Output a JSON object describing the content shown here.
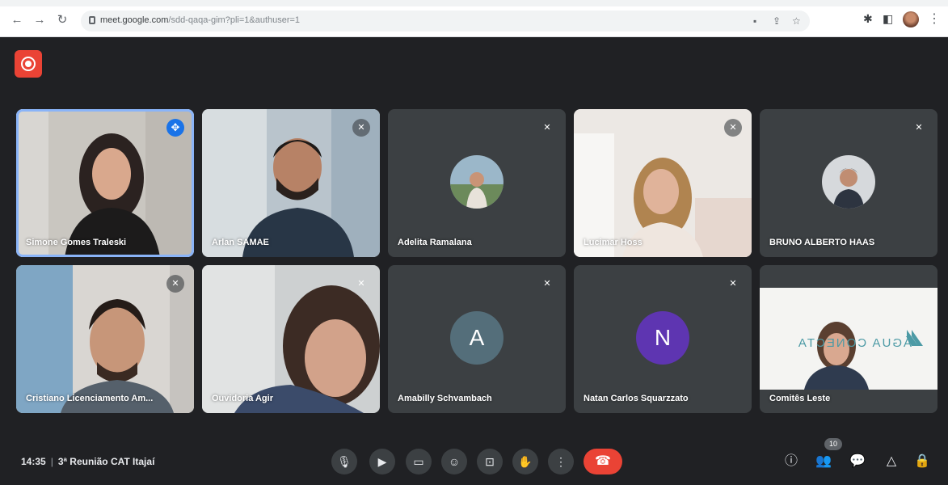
{
  "browser": {
    "url_host": "meet.google.com",
    "url_path": "/sdd-qaqa-gim?pli=1&authuser=1"
  },
  "tiles": [
    {
      "name": "Simone Gomes Traleski",
      "kind": "video",
      "active": true
    },
    {
      "name": "Arlan SAMAE",
      "kind": "video"
    },
    {
      "name": "Adelita Ramalana",
      "kind": "avatar-photo"
    },
    {
      "name": "Lucimar Hoss",
      "kind": "video"
    },
    {
      "name": "BRUNO ALBERTO HAAS",
      "kind": "avatar-photo"
    },
    {
      "name": "Cristiano Licenciamento Am...",
      "kind": "video"
    },
    {
      "name": "Ouvidoria Agir",
      "kind": "video"
    },
    {
      "name": "Amabilly Schvambach",
      "kind": "avatar-letter",
      "letter": "A",
      "color": "#546e7a"
    },
    {
      "name": "Natan Carlos Squarzzato",
      "kind": "avatar-letter",
      "letter": "N",
      "color": "#5e35b1"
    },
    {
      "name": "Comitês Leste",
      "kind": "video"
    }
  ],
  "tile_overlay": {
    "logo_text": "ÁGUA CONECTA"
  },
  "bottom_bar": {
    "time": "14:35",
    "meeting_title": "3ª Reunião CAT Itajaí",
    "people_count": "10"
  },
  "colors": {
    "background": "#202124",
    "tile": "#3c4043",
    "hangup": "#ea4335",
    "recording": "#ea4335",
    "active_outline": "#8ab4f8",
    "pin": "#1a73e8"
  }
}
